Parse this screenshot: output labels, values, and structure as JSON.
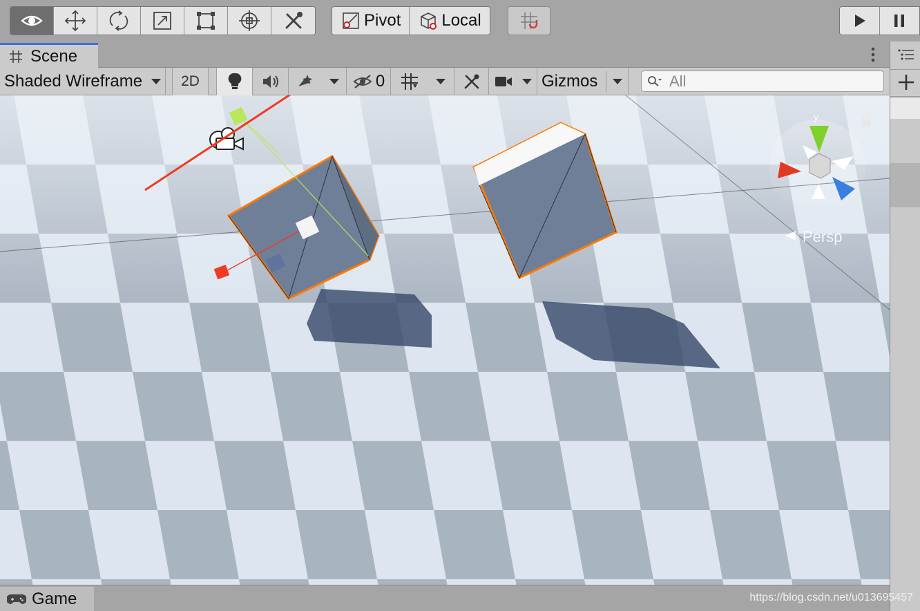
{
  "toolbar": {
    "tools": [
      {
        "name": "view-tool",
        "icon": "eye-icon",
        "active": true
      },
      {
        "name": "move-tool",
        "icon": "move-arrows-icon"
      },
      {
        "name": "rotate-tool",
        "icon": "rotate-icon"
      },
      {
        "name": "scale-tool",
        "icon": "scale-icon"
      },
      {
        "name": "rect-tool",
        "icon": "rect-transform-icon"
      },
      {
        "name": "transform-tool",
        "icon": "transform-icon"
      },
      {
        "name": "custom-tool",
        "icon": "tools-icon"
      }
    ],
    "pivot_label": "Pivot",
    "local_label": "Local",
    "snap_icon": "grid-snap-icon",
    "play_icon": "play-icon",
    "pause_icon": "pause-icon"
  },
  "scene_tab": {
    "label": "Scene",
    "icon": "hash-grid-icon"
  },
  "scene_options": {
    "draw_mode": "Shaded Wireframe",
    "mode_2d": "2D",
    "hidden_count": "0",
    "gizmos_label": "Gizmos",
    "search_placeholder": "All"
  },
  "viewport": {
    "persp_label": "Persp",
    "selection_color": "#ff7a00",
    "annotation_color": "#f03a24"
  },
  "game_tab": {
    "label": "Game",
    "icon": "gamepad-icon"
  },
  "watermark": "https://blog.csdn.net/u013695457"
}
